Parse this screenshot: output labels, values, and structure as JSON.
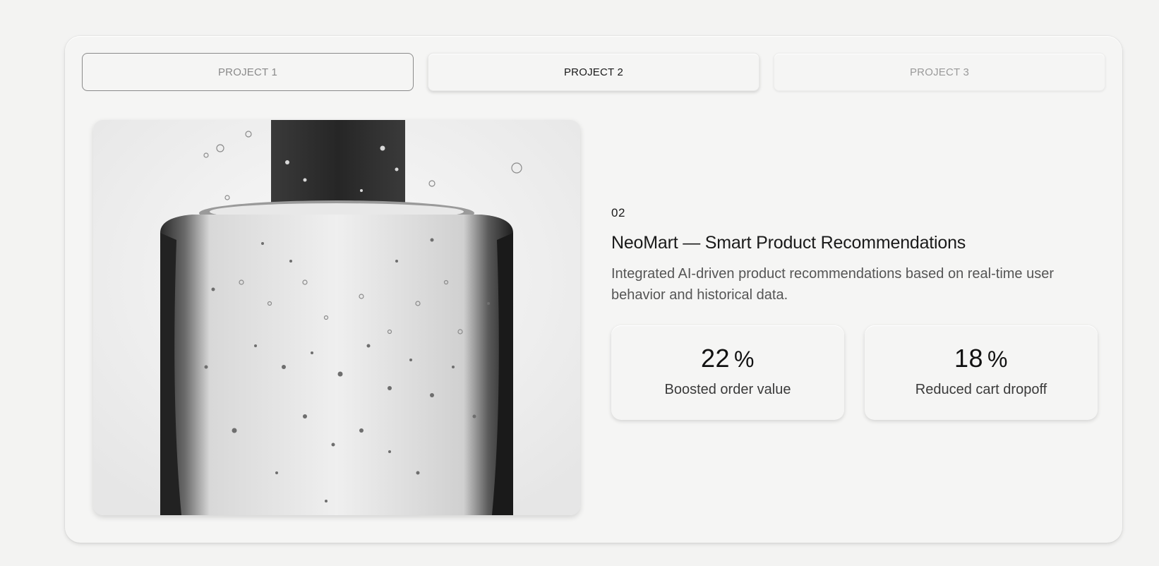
{
  "tabs": [
    {
      "label": "PROJECT 1"
    },
    {
      "label": "PROJECT 2"
    },
    {
      "label": "PROJECT 3"
    }
  ],
  "project": {
    "index": "02",
    "title": "NeoMart — Smart Product Recommendations",
    "description": "Integrated AI-driven product recommendations based on real-time user behavior and historical data.",
    "stats": [
      {
        "value": "22",
        "unit": "%",
        "label": "Boosted order value"
      },
      {
        "value": "18",
        "unit": "%",
        "label": "Reduced cart dropoff"
      }
    ]
  },
  "colors": {
    "background": "#f3f3f2",
    "card": "#f5f5f4",
    "text": "#1a1a1a",
    "muted": "#8a8a8a"
  },
  "icons": {
    "image": "glass-bottle-with-bubbles-photo"
  }
}
